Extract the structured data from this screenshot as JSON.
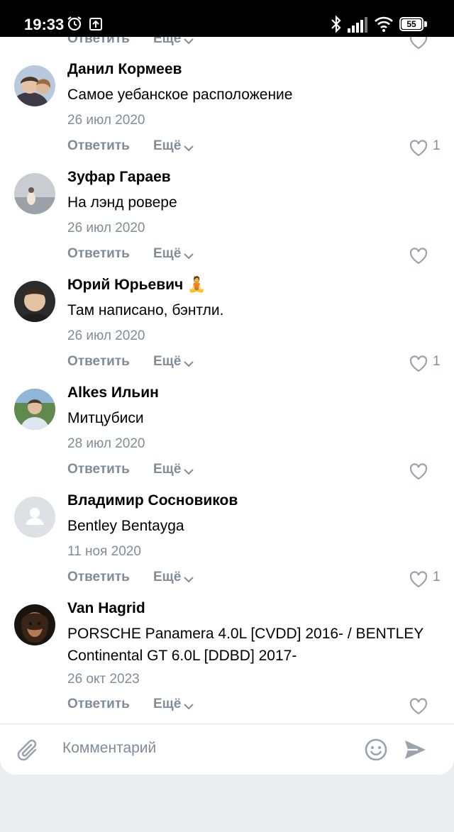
{
  "status_bar": {
    "time": "19:33",
    "battery": "55"
  },
  "actions": {
    "reply": "Ответить",
    "more": "Ещё"
  },
  "partial_top": {
    "reply": "Ответить",
    "more": "Ещё"
  },
  "comments": [
    {
      "name": "Данил Кормеев",
      "text": "Самое уебанское расположение",
      "date": "26 июл 2020",
      "likes": "1"
    },
    {
      "name": "Зуфар Гараев",
      "text": "На лэнд ровере",
      "date": "26 июл 2020",
      "likes": ""
    },
    {
      "name": "Юрий Юрьевич 🧘",
      "text": "Там написано, бэнтли.",
      "date": "26 июл 2020",
      "likes": "1"
    },
    {
      "name": "Alkes Ильин",
      "text": "Митцубиси",
      "date": "28 июл 2020",
      "likes": ""
    },
    {
      "name": "Владимир Сосновиков",
      "text": "Bentley Bentayga",
      "date": "11 ноя 2020",
      "likes": "1"
    },
    {
      "name": "Van Hagrid",
      "text": "PORSCHE Panamera 4.0L [CVDD] 2016- / BENTLEY Continental GT 6.0L [DDBD] 2017-",
      "date": "26 окт 2023",
      "likes": ""
    }
  ],
  "composer": {
    "placeholder": "Комментарий"
  },
  "colors": {
    "secondary_text": "#818c99",
    "accent": "#99a2ad",
    "background": "#ebedf0"
  },
  "icons": [
    "alarm-icon",
    "upload-icon",
    "bluetooth-icon",
    "signal-icon",
    "wifi-icon",
    "battery-icon",
    "chevron-down-icon",
    "heart-icon",
    "paperclip-icon",
    "smile-icon",
    "send-icon"
  ]
}
